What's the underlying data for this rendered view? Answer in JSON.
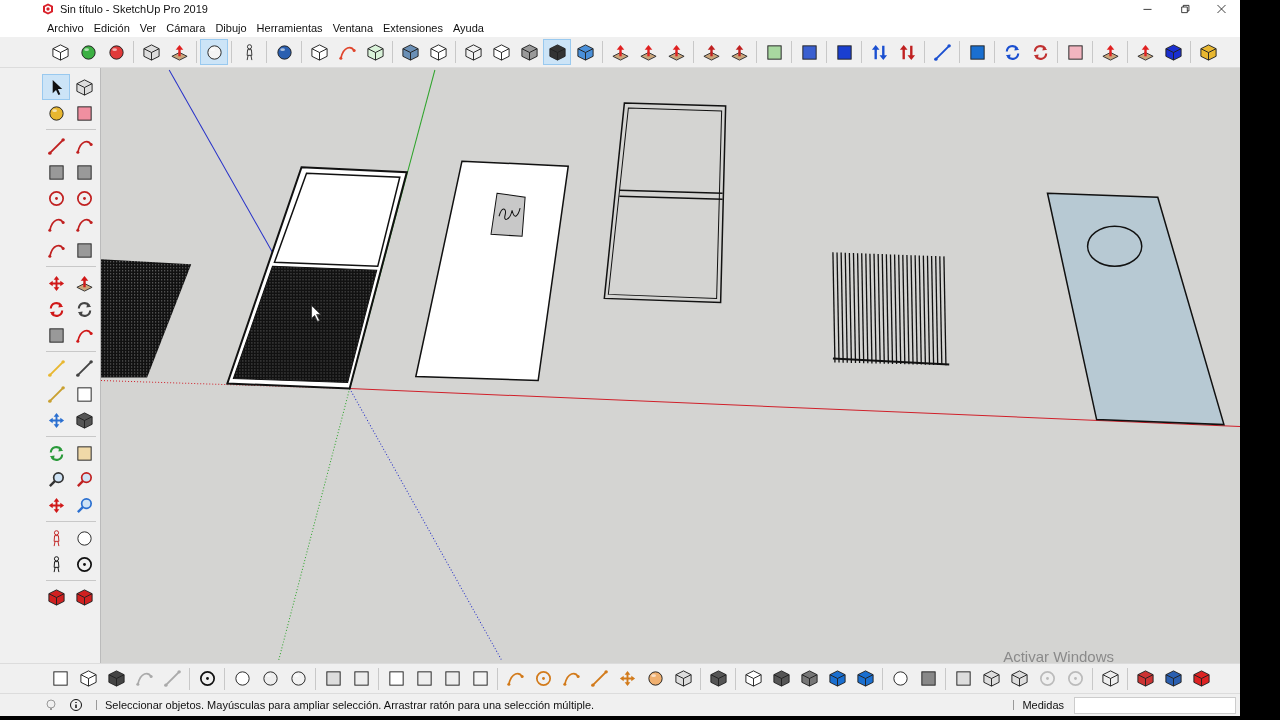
{
  "window": {
    "title": "Sin título - SketchUp Pro 2019"
  },
  "menu": [
    "Archivo",
    "Edición",
    "Ver",
    "Cámara",
    "Dibujo",
    "Herramientas",
    "Ventana",
    "Extensiones",
    "Ayuda"
  ],
  "top_toolbar": [
    {
      "selected": false
    },
    {
      "selected": false
    },
    {
      "selected": false
    },
    {
      "selected": false
    },
    {
      "selected": false
    },
    {
      "selected": true
    },
    {
      "selected": false
    },
    {
      "selected": false
    },
    {
      "selected": false
    },
    {
      "selected": false
    },
    {
      "selected": false
    },
    {
      "selected": false
    },
    {
      "selected": false
    },
    {
      "selected": false
    },
    {
      "selected": false
    },
    {
      "selected": false
    },
    {
      "selected": true
    },
    {
      "selected": false
    },
    {
      "selected": false
    },
    {
      "selected": false
    },
    {
      "selected": false
    },
    {
      "selected": false
    },
    {
      "selected": false
    },
    {
      "selected": false
    },
    {
      "selected": false
    },
    {
      "selected": false
    },
    {
      "selected": false
    },
    {
      "selected": false
    },
    {
      "selected": false
    },
    {
      "selected": false
    },
    {
      "selected": false
    },
    {
      "selected": false
    },
    {
      "selected": false
    },
    {
      "selected": false
    },
    {
      "selected": false
    },
    {
      "selected": false
    },
    {
      "selected": false
    }
  ],
  "left_toolbar": [
    {
      "selected": true
    },
    {
      "selected": false
    },
    {
      "selected": false
    },
    {
      "selected": false
    },
    {
      "selected": false
    },
    {
      "selected": false
    },
    {
      "selected": false
    },
    {
      "selected": false
    },
    {
      "selected": false
    },
    {
      "selected": false
    },
    {
      "selected": false
    },
    {
      "selected": false
    },
    {
      "selected": false
    },
    {
      "selected": false
    },
    {
      "selected": false
    },
    {
      "selected": false
    },
    {
      "selected": false
    },
    {
      "selected": false
    },
    {
      "selected": false
    },
    {
      "selected": false
    },
    {
      "selected": false
    },
    {
      "selected": false
    },
    {
      "selected": false
    },
    {
      "selected": false
    },
    {
      "selected": false
    },
    {
      "selected": false
    },
    {
      "selected": false
    },
    {
      "selected": false
    },
    {
      "selected": false
    },
    {
      "selected": false
    },
    {
      "selected": false
    },
    {
      "selected": false
    },
    {
      "selected": false
    },
    {
      "selected": false
    },
    {
      "selected": false
    },
    {
      "selected": false
    },
    {
      "selected": false
    },
    {
      "selected": false
    }
  ],
  "bottom_toolbar": [
    {
      "selected": false
    },
    {
      "selected": false
    },
    {
      "selected": false
    },
    {
      "selected": false
    },
    {
      "selected": false
    },
    {
      "selected": false
    },
    {
      "selected": false
    },
    {
      "selected": false
    },
    {
      "selected": false
    },
    {
      "selected": false
    },
    {
      "selected": false
    },
    {
      "selected": false
    },
    {
      "selected": false
    },
    {
      "selected": false
    },
    {
      "selected": false
    },
    {
      "selected": false
    },
    {
      "selected": false
    },
    {
      "selected": false
    },
    {
      "selected": false
    },
    {
      "selected": false
    },
    {
      "selected": false
    },
    {
      "selected": false
    },
    {
      "selected": false
    },
    {
      "selected": false
    },
    {
      "selected": false
    },
    {
      "selected": false
    },
    {
      "selected": false
    },
    {
      "selected": false
    },
    {
      "selected": false
    },
    {
      "selected": false
    },
    {
      "selected": false
    },
    {
      "selected": false
    },
    {
      "selected": false
    },
    {
      "selected": false
    },
    {
      "selected": false
    },
    {
      "selected": false
    },
    {
      "selected": false
    },
    {
      "selected": false
    },
    {
      "selected": false
    }
  ],
  "viewport": {
    "notice": "Activar Windows"
  },
  "status_bar": {
    "message": "Seleccionar objetos. Mayúsculas para ampliar selección. Arrastrar ratón para una selección múltiple.",
    "measurements_label": "Medidas"
  }
}
